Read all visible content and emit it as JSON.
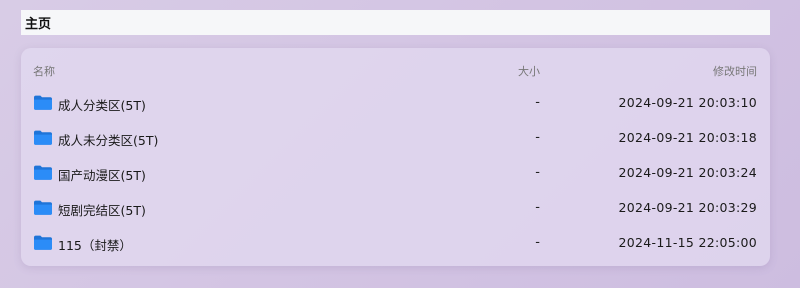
{
  "breadcrumb": {
    "home_label": "主页"
  },
  "table": {
    "headers": {
      "name": "名称",
      "size": "大小",
      "modified": "修改时间"
    },
    "rows": [
      {
        "name": "成人分类区(5T)",
        "size": "-",
        "modified": "2024-09-21 20:03:10",
        "icon": "folder-icon"
      },
      {
        "name": "成人未分类区(5T)",
        "size": "-",
        "modified": "2024-09-21 20:03:18",
        "icon": "folder-icon"
      },
      {
        "name": "国产动漫区(5T)",
        "size": "-",
        "modified": "2024-09-21 20:03:24",
        "icon": "folder-icon"
      },
      {
        "name": "短剧完结区(5T)",
        "size": "-",
        "modified": "2024-09-21 20:03:29",
        "icon": "folder-icon"
      },
      {
        "name": "115（封禁）",
        "size": "-",
        "modified": "2024-11-15 22:05:00",
        "icon": "folder-icon"
      }
    ]
  },
  "colors": {
    "folder": "#2b8cf7",
    "folder_dark": "#1f74d8"
  }
}
